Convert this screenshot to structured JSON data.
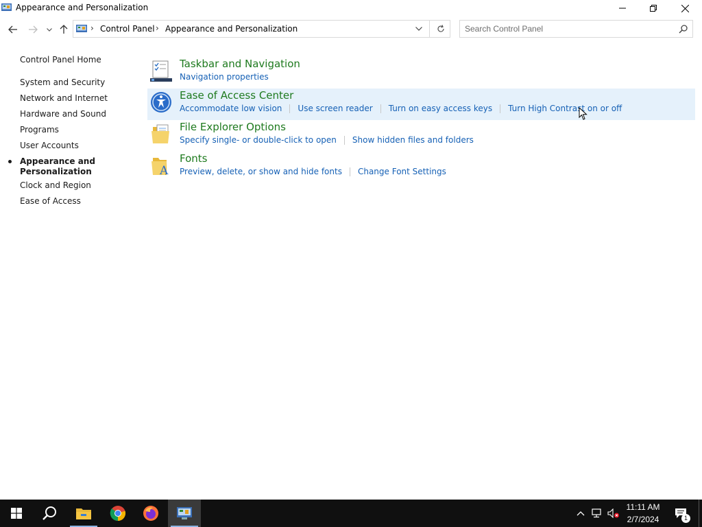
{
  "window": {
    "title": "Appearance and Personalization"
  },
  "address": {
    "crumbs": [
      "Control Panel",
      "Appearance and Personalization"
    ]
  },
  "search": {
    "placeholder": "Search Control Panel"
  },
  "sidebar": {
    "home": "Control Panel Home",
    "items": [
      "System and Security",
      "Network and Internet",
      "Hardware and Sound",
      "Programs",
      "User Accounts"
    ],
    "active_line1": "Appearance and",
    "active_line2": "Personalization",
    "after_items": [
      "Clock and Region",
      "Ease of Access"
    ]
  },
  "categories": [
    {
      "title": "Taskbar and Navigation",
      "links": [
        "Navigation properties"
      ]
    },
    {
      "title": "Ease of Access Center",
      "links": [
        "Accommodate low vision",
        "Use screen reader",
        "Turn on easy access keys",
        "Turn High Contrast on or off"
      ]
    },
    {
      "title": "File Explorer Options",
      "links": [
        "Specify single- or double-click to open",
        "Show hidden files and folders"
      ]
    },
    {
      "title": "Fonts",
      "links": [
        "Preview, delete, or show and hide fonts",
        "Change Font Settings"
      ]
    }
  ],
  "taskbar": {
    "time": "11:11 AM",
    "date": "2/7/2024",
    "notification_count": "1"
  },
  "colors": {
    "category_title": "#1e7a1e",
    "link": "#1560b5",
    "hover_row": "#e5f1fb",
    "taskbar": "#101010"
  }
}
